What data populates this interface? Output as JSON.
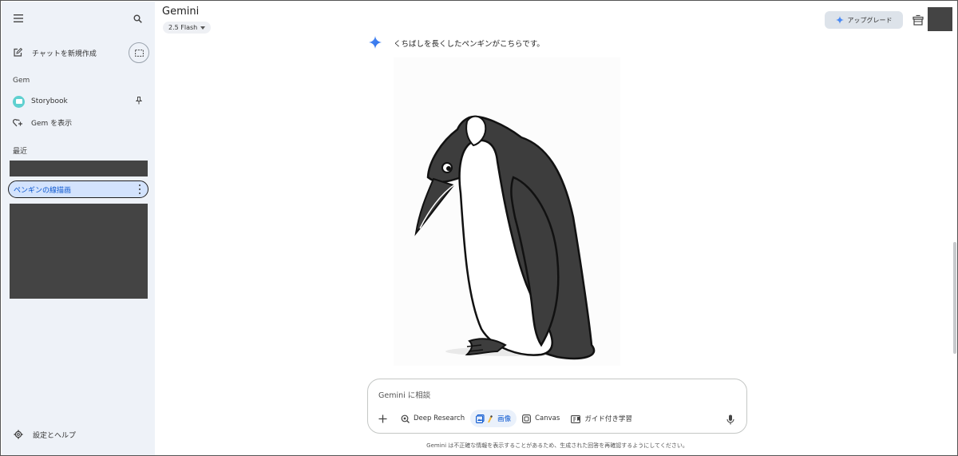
{
  "sidebar": {
    "new_chat_label": "チャットを新規作成",
    "gem_section_label": "Gem",
    "gems": [
      {
        "label": "Storybook",
        "icon": "storybook-icon"
      },
      {
        "label": "Gem を表示",
        "icon": "gem-add-icon"
      }
    ],
    "recent_section_label": "最近",
    "recent_chats": [
      {
        "label": "ペンギンの線描画",
        "active": true
      }
    ],
    "settings_label": "設定とヘルプ"
  },
  "header": {
    "title": "Gemini",
    "model_label": "2.5 Flash",
    "upgrade_label": "アップグレード"
  },
  "response": {
    "text": "くちばしを長くしたペンギンがこちらです。",
    "image_alt": "penguin line drawing"
  },
  "composer": {
    "placeholder": "Gemini に相談",
    "tools": [
      {
        "label": "Deep Research",
        "icon": "deep-research-icon",
        "active": false
      },
      {
        "label": "画像",
        "icon": "image-tool-icon",
        "active": true
      },
      {
        "label": "Canvas",
        "icon": "canvas-icon",
        "active": false
      },
      {
        "label": "ガイド付き学習",
        "icon": "guided-learning-icon",
        "active": false
      }
    ]
  },
  "footer": {
    "disclaimer": "Gemini は不正確な情報を表示することがあるため、生成された回答を再確認するようにしてください。"
  },
  "colors": {
    "sidebar_bg": "#eef2f8",
    "active_chat_bg": "#d3e3fd",
    "accent": "#0b57d0",
    "penguin_dark": "#3d3d3d"
  }
}
